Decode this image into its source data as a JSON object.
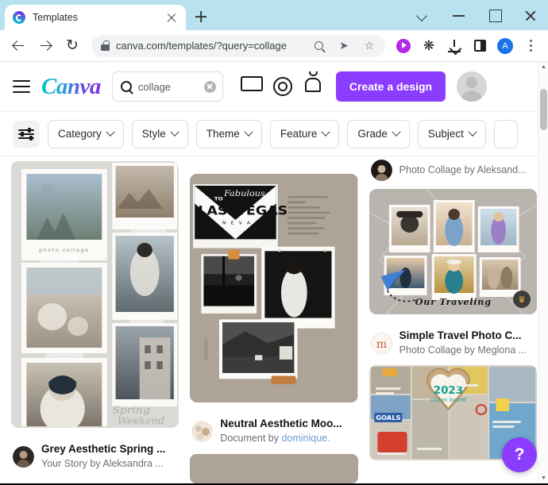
{
  "browser": {
    "tab": {
      "title": "Templates",
      "favicon_icon": "canva-favicon"
    },
    "new_tab_label": "+",
    "window_controls": {
      "chevron": "chevron-down-icon",
      "minimize": "minimize-icon",
      "maximize": "maximize-icon",
      "close": "close-icon"
    },
    "nav": {
      "back": "back-arrow-icon",
      "forward": "forward-arrow-icon",
      "reload": "↻"
    },
    "omnibox": {
      "url": "canva.com/templates/?query=collage",
      "lock_icon": "lock-icon",
      "search_icon": "search-icon",
      "share_icon": "share-icon",
      "bookmark_icon": "star-icon"
    },
    "extensions": [
      {
        "name": "media-player-icon"
      },
      {
        "name": "puzzle-extensions-icon",
        "glyph": "✦"
      },
      {
        "name": "downloads-icon"
      },
      {
        "name": "side-panel-icon"
      },
      {
        "name": "profile-avatar",
        "initial": "A"
      },
      {
        "name": "chrome-menu-icon"
      }
    ]
  },
  "canva": {
    "menu_icon": "hamburger-menu-icon",
    "logo_text": "Canva",
    "search": {
      "value": "collage",
      "placeholder": "Search",
      "icon": "search-icon",
      "clear_icon": "clear-icon"
    },
    "header_icons": [
      {
        "name": "monitor-icon"
      },
      {
        "name": "gear-icon"
      },
      {
        "name": "bell-icon"
      }
    ],
    "create_button": "Create a design",
    "avatar": "user-avatar",
    "accent_color": "#8b3dff"
  },
  "filters": {
    "sliders_icon": "filter-sliders-icon",
    "chips": [
      {
        "label": "Category"
      },
      {
        "label": "Style"
      },
      {
        "label": "Theme"
      },
      {
        "label": "Feature"
      },
      {
        "label": "Grade"
      },
      {
        "label": "Subject"
      }
    ]
  },
  "results": {
    "columns": [
      {
        "cards": [
          {
            "name": "grey-aesthetic-spring",
            "title": "Grey Aesthetic Spring ...",
            "subtitle": "Your Story by Aleksandra ...",
            "subtitle_plain": "Your Story by ",
            "subtitle_link": "Aleksandra ...",
            "caption_text": "photo collage",
            "signature_1": "Spring",
            "signature_2": "Weekend",
            "pro": false
          }
        ]
      },
      {
        "cards": [
          {
            "name": "neutral-aesthetic-moodboard",
            "title": "Neutral Aesthetic Moo...",
            "subtitle_plain": "Document by ",
            "subtitle_link": "dominique.",
            "headline_small": "TO",
            "headline_script": "Fabulous",
            "headline_big": "LAS VEGAS",
            "headline_sub": "N E V A D A",
            "body_text": "Lorem ipsum dolor sit amet, consectetur adipiscing elit. Sed a condimentum urna, ut eleifend neque. Etiam euismod vestibulum arcu.",
            "side_label": "01/04/23",
            "pro": false
          }
        ]
      },
      {
        "cards": [
          {
            "name": "photo-collage-partial-top",
            "subtitle": "Photo Collage by Aleksand...",
            "partial": true
          },
          {
            "name": "simple-travel-photo-collage",
            "title": "Simple Travel Photo C...",
            "subtitle_plain": "Photo Collage by ",
            "subtitle_link": "Meglona ...",
            "overlay_text": "Our Traveling",
            "pro": true,
            "pro_badge_icon": "crown-icon"
          },
          {
            "name": "vision-board-2023",
            "year_text": "2023",
            "script_text": "vision board",
            "goals_text": "GOALS",
            "partial": true
          }
        ]
      }
    ]
  },
  "help_button": {
    "label": "?",
    "name": "help-button"
  },
  "scrollbar": {
    "up_icon": "▲",
    "down_icon": "▼"
  }
}
